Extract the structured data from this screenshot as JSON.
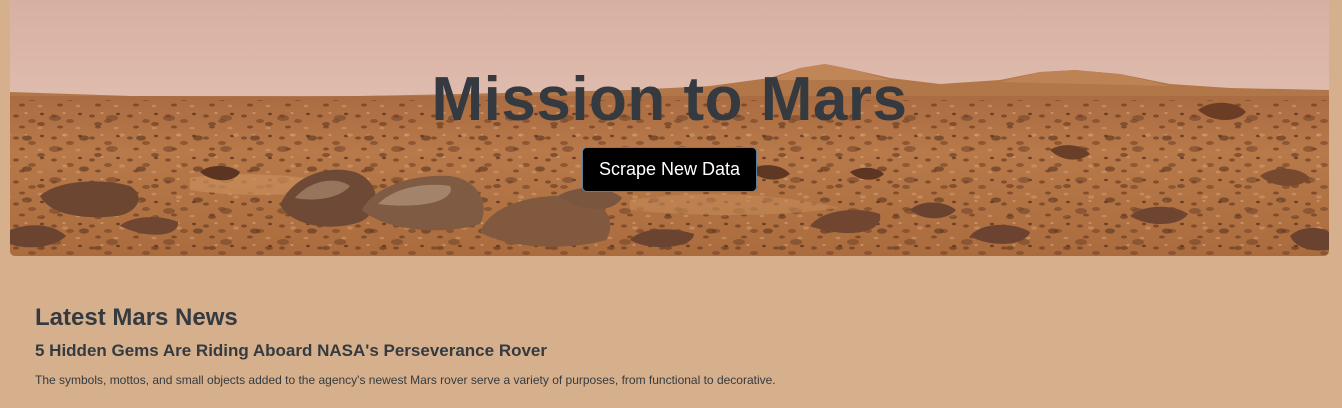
{
  "hero": {
    "title": "Mission to Mars",
    "button_label": "Scrape New Data"
  },
  "news": {
    "heading": "Latest Mars News",
    "title": "5 Hidden Gems Are Riding Aboard NASA's Perseverance Rover",
    "teaser": "The symbols, mottos, and small objects added to the agency's newest Mars rover serve a variety of purposes, from functional to decorative."
  },
  "colors": {
    "page_background": "#d6b08c",
    "text": "#343a40",
    "button_background": "#000000",
    "button_text": "#ffffff"
  }
}
